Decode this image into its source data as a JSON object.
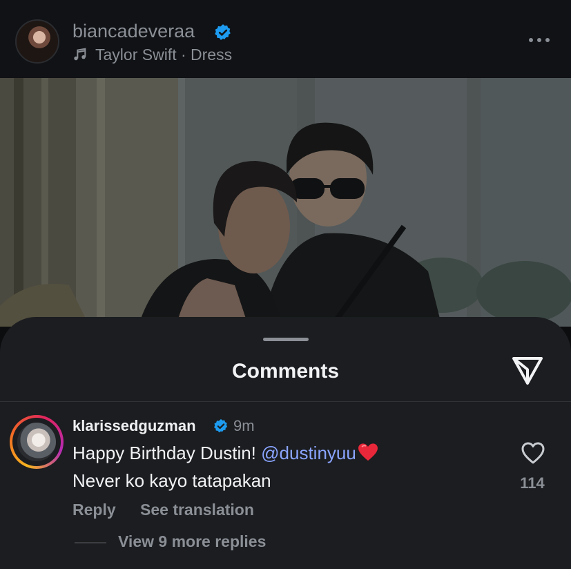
{
  "post": {
    "username": "biancadeveraa",
    "song": "Taylor Swift · Dress"
  },
  "comments_sheet": {
    "title": "Comments",
    "comment": {
      "username": "klarissedguzman",
      "time": "9m",
      "text_before_mention": "Happy Birthday Dustin! ",
      "mention": "@dustinyuu",
      "text_line2": "Never ko kayo tatapakan",
      "likes": "114",
      "reply_label": "Reply",
      "translate_label": "See translation",
      "view_replies_label": "View 9 more replies"
    }
  },
  "colors": {
    "background": "#0c0d0f",
    "sheet": "#1b1d20",
    "muted_text": "#8b8f96",
    "mention": "#8aa4ff",
    "verified": "#1d9bf0"
  },
  "icons": [
    "verified-badge-icon",
    "music-note-icon",
    "more-icon",
    "share-icon",
    "heart-icon",
    "red-heart-emoji"
  ]
}
